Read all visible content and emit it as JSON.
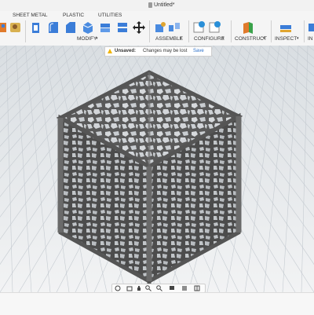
{
  "window": {
    "title": "Untitled*"
  },
  "toolbar": {
    "tabs": [
      "SHEET METAL",
      "PLASTIC",
      "UTILITIES"
    ],
    "groups": [
      "MODIFY",
      "ASSEMBLE",
      "CONFIGURE",
      "CONSTRUCT",
      "INSPECT",
      "IN"
    ]
  },
  "notice": {
    "label": "Unsaved:",
    "message": "Changes may be lost",
    "action": "Save"
  },
  "colors": {
    "accent": "#2a6fc9",
    "warning": "#f0b400",
    "model": "#5a5a5a"
  }
}
